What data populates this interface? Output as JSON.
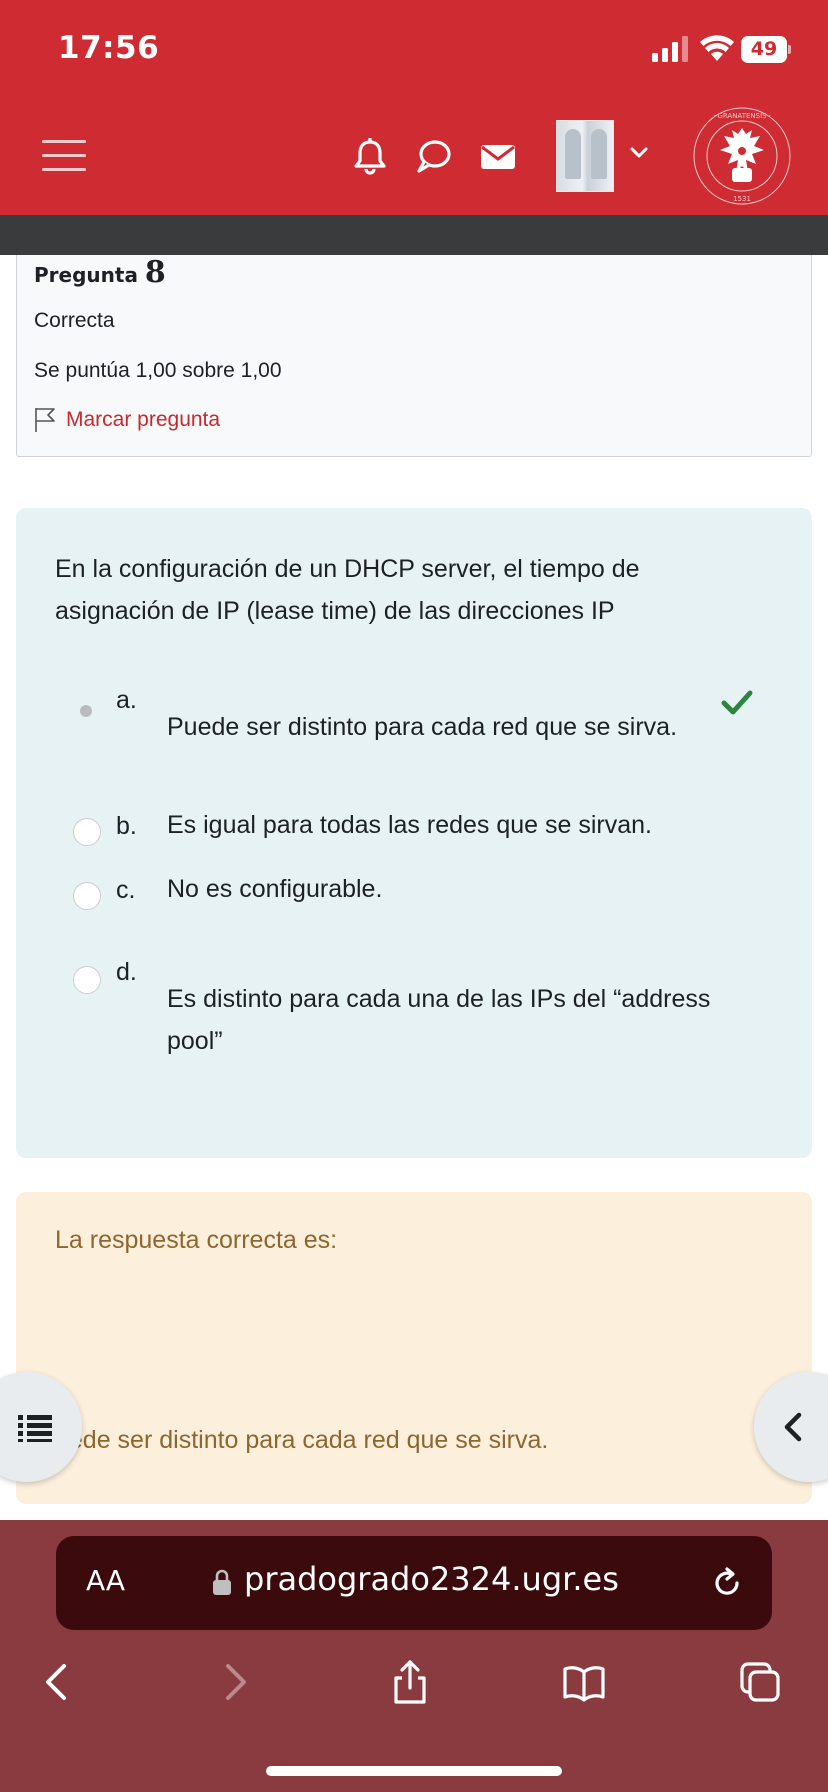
{
  "status_bar": {
    "time": "17:56",
    "battery": "49"
  },
  "header": {
    "icons": [
      "hamburger-menu-icon",
      "bell-icon",
      "chat-bubble-icon",
      "envelope-icon",
      "avatar",
      "chevron-down-icon",
      "university-seal"
    ],
    "seal_text": "UNIVERSITAS · GRANATENSIS · 1531"
  },
  "question": {
    "label": "Pregunta",
    "number": "8",
    "status": "Correcta",
    "grade": "Se puntúa 1,00 sobre 1,00",
    "flag_label": "Marcar pregunta"
  },
  "question_text": {
    "line1": "En la configuración de un DHCP server, el  tiempo de",
    "line2": "asignación de IP (lease time) de las direcciones IP"
  },
  "options": [
    {
      "letter": "a.",
      "text": "Puede  ser distinto para cada red que se sirva.",
      "selected": true,
      "correct": true
    },
    {
      "letter": "b.",
      "text": "Es igual para todas las redes que se sirvan.",
      "selected": false
    },
    {
      "letter": "c.",
      "text": "No es configurable.",
      "selected": false
    },
    {
      "letter": "d.",
      "line1": "Es distinto para cada una de las IPs del “address",
      "line2": "pool”",
      "selected": false
    }
  ],
  "feedback": {
    "label": "La respuesta correcta es:",
    "answer": "uede  ser distinto para cada red que se sirva."
  },
  "browser": {
    "aa_label": "AA",
    "url": "pradogrado2324.ugr.es"
  },
  "colors": {
    "header_red": "#cf2b32",
    "question_bg": "#e6f2f3",
    "feedback_bg": "#fcefdc",
    "feedback_text": "#8e662e",
    "check_green": "#2e8540",
    "browser_bg": "#8a3b3f"
  }
}
